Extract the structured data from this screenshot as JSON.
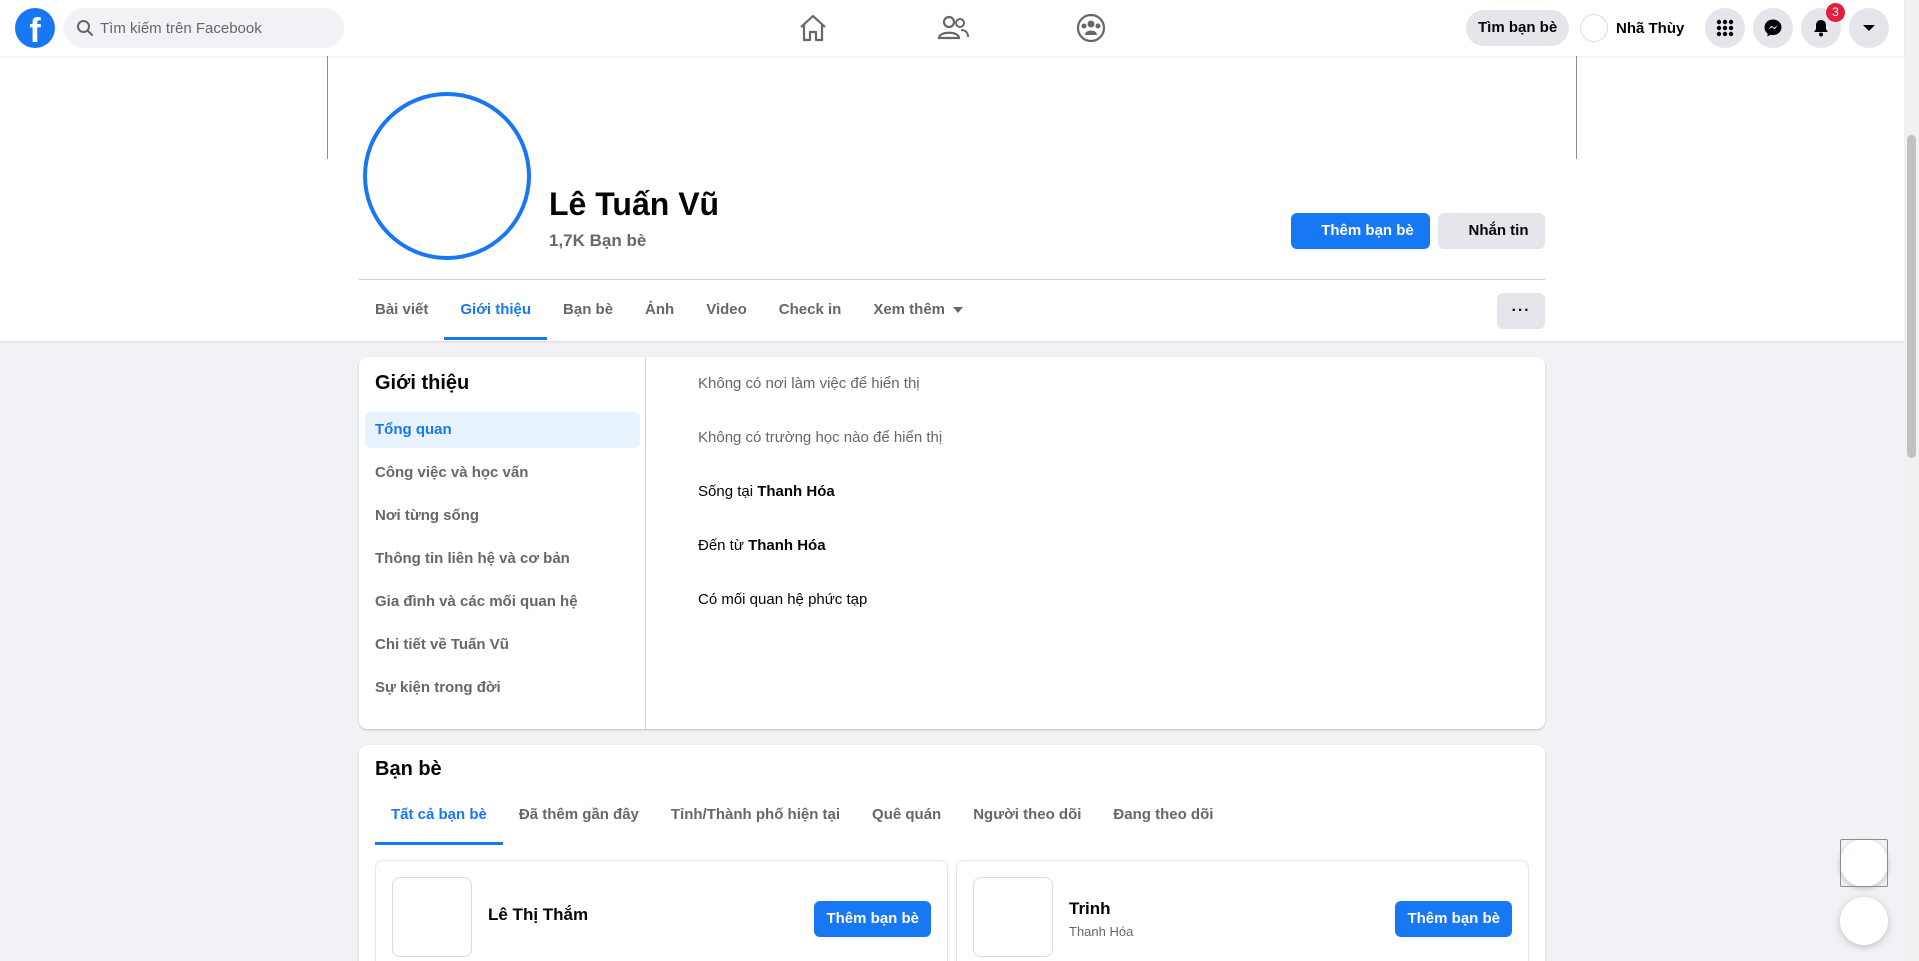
{
  "header": {
    "logo_letter": "f",
    "search_placeholder": "Tìm kiếm trên Facebook",
    "find_friends_label": "Tìm bạn bè",
    "user_name": "Nhã Thùy",
    "notification_count": "3",
    "accent_color": "#1877f2"
  },
  "profile": {
    "name": "Lê Tuấn Vũ",
    "friend_count": "1,7K Bạn bè",
    "add_friend_label": "Thêm bạn bè",
    "message_label": "Nhắn tin",
    "tabs": [
      "Bài viết",
      "Giới thiệu",
      "Bạn bè",
      "Ảnh",
      "Video",
      "Check in",
      "Xem thêm"
    ],
    "active_tab": "Giới thiệu",
    "more_label": "···"
  },
  "about": {
    "title": "Giới thiệu",
    "side_items": [
      "Tổng quan",
      "Công việc và học vấn",
      "Nơi từng sống",
      "Thông tin liên hệ và cơ bản",
      "Gia đình và các mối quan hệ",
      "Chi tiết về Tuấn Vũ",
      "Sự kiện trong đời"
    ],
    "no_work": "Không có nơi làm việc để hiển thị",
    "no_school": "Không có trường học nào để hiển thị",
    "lives_prefix": "Sống tại ",
    "lives_place": "Thanh Hóa",
    "from_prefix": "Đến từ ",
    "from_place": "Thanh Hóa",
    "relationship": "Có mối quan hệ phức tạp"
  },
  "friends": {
    "title": "Bạn bè",
    "tabs": [
      "Tất cả bạn bè",
      "Đã thêm gần đây",
      "Tỉnh/Thành phố hiện tại",
      "Quê quán",
      "Người theo dõi",
      "Đang theo dõi"
    ],
    "list": [
      {
        "name": "Lê Thị Thắm",
        "subtitle": "",
        "button": "Thêm bạn bè"
      },
      {
        "name": "Trinh",
        "subtitle": "Thanh Hóa",
        "button": "Thêm bạn bè"
      }
    ]
  }
}
